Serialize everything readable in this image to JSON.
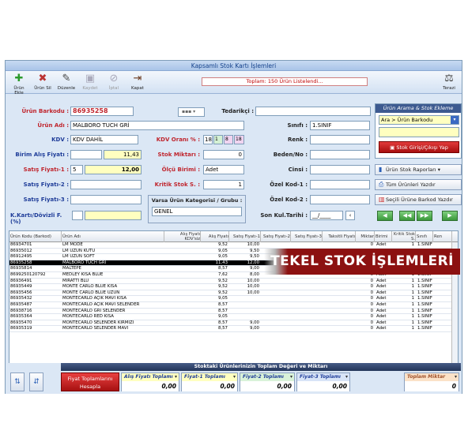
{
  "window": {
    "title": "Kapsamlı Stok Kartı İşlemleri"
  },
  "toolbar": {
    "buttons": [
      {
        "label": "Ürün Ekle",
        "icon": "plus-icon"
      },
      {
        "label": "Ürün Sil",
        "icon": "delete-icon"
      },
      {
        "label": "Düzenle",
        "icon": "edit-icon"
      },
      {
        "label": "Kaydet",
        "icon": "save-icon"
      },
      {
        "label": "İptal",
        "icon": "cancel-icon"
      },
      {
        "label": "Kapat",
        "icon": "exit-icon"
      }
    ],
    "banner": "Toplam: 150 Ürün Listelendi...",
    "terazi": "Terazi"
  },
  "form": {
    "barcode_label": "Ürün Barkodu :",
    "barcode": "86935258",
    "tedarikci_label": "Tedarikçi :",
    "tedarikci": "",
    "urun_adi_label": "Ürün Adı :",
    "urun_adi": "MALBORO TUCH GRİ",
    "sinifi_label": "Sınıfı :",
    "sinifi": "1.SINIF",
    "kdv_label": "KDV :",
    "kdv": "KDV DAHİL",
    "kdv_orani_label": "KDV Oranı % :",
    "kdv_rates": [
      "18",
      "1",
      "8",
      "18"
    ],
    "renk_label": "Renk :",
    "renk": "",
    "birim_alis_label": "Birim Alış Fiyatı :",
    "birim_alis": "11,43",
    "stok_miktari_label": "Stok Miktarı :",
    "stok_miktari": "0",
    "beden_label": "Beden/No :",
    "beden": "",
    "satis1_label": "Satış Fiyatı-1 :",
    "satis1_pct": "5",
    "satis1": "12,00",
    "olcu_label": "Ölçü Birimi :",
    "olcu": "Adet",
    "cinsi_label": "Cinsi :",
    "cinsi": "",
    "satis2_label": "Satış Fiyatı-2 :",
    "kritik_label": "Kritik Stok S. :",
    "kritik": "1",
    "ozel1_label": "Özel Kod-1 :",
    "satis3_label": "Satış Fiyatı-3 :",
    "grup_label": "Varsa Ürün Kategorisi / Grubu :",
    "grup": "GENEL",
    "ozel2_label": "Özel Kod-2 :",
    "kkarti_label": "K.Kartı/Dövizli F.(%)",
    "son_kul_label": "Son Kul.Tarihi :",
    "son_kul": "__/____"
  },
  "search": {
    "title": "Ürün Arama & Stok Ekleme",
    "selected": "Ara > Ürün Barkodu",
    "stok_button": "Stok Girişi/Çıkışı Yap"
  },
  "side_buttons": {
    "rapor": "Ürün Stok Raporları",
    "yazdir": "Tüm Ürünleri Yazdır",
    "barkod": "Seçili Ürüne Barkod Yazdır"
  },
  "grid": {
    "headers": [
      "Ürün Kodu (Barkod)",
      "Ürün Adı",
      "Alış Fiyatı KDV'siz",
      "Alış Fiyatı",
      "Satış Fiyatı-1",
      "Satış Fiyatı-2",
      "Satış Fiyatı-3",
      "Taksitli Fiyatı",
      "Miktar",
      "Birimi",
      "Kritik Stok S.",
      "Sınıfı",
      "Ren"
    ],
    "rows": [
      [
        "86934701",
        "LM MODE",
        "",
        "9,52",
        "10,00",
        "",
        "",
        "",
        "0",
        "Adet",
        "1",
        "1.SINIF"
      ],
      [
        "86935012",
        "LM UZUN KUTU",
        "",
        "9,05",
        "9,50",
        "",
        "",
        "",
        "0",
        "Adet",
        "1",
        "1.SINIF"
      ],
      [
        "86912495",
        "LM UZUN SOFT",
        "",
        "9,05",
        "9,50",
        "",
        "",
        "",
        "0",
        "Adet",
        "1",
        "1.SINIF"
      ],
      [
        "86935258",
        "MALBORO TUCH GRİ",
        "",
        "11,43",
        "12,00",
        "",
        "",
        "",
        "0",
        "Adet",
        "1",
        "1.SINIF"
      ],
      [
        "86935814",
        "MALTEPE",
        "",
        "8,57",
        "9,00",
        "",
        "",
        "",
        "0",
        "Adet",
        "1",
        "1.SINIF"
      ],
      [
        "8699250120792",
        "MEDLEY KISA BLUE",
        "",
        "7,62",
        "8,00",
        "",
        "",
        "",
        "0",
        "Adet",
        "1",
        "1.SINIF"
      ],
      [
        "86936491",
        "MİRATTİ BLU",
        "",
        "9,52",
        "10,00",
        "",
        "",
        "",
        "0",
        "Adet",
        "1",
        "1.SINIF"
      ],
      [
        "86935449",
        "MONTE CARLO BLUE KISA",
        "",
        "9,52",
        "10,00",
        "",
        "",
        "",
        "0",
        "Adet",
        "1",
        "1.SINIF"
      ],
      [
        "86935456",
        "MONTE CARLO BLUE UZUN",
        "",
        "9,52",
        "10,00",
        "",
        "",
        "",
        "0",
        "Adet",
        "1",
        "1.SINIF"
      ],
      [
        "86935432",
        "MONTECARLO AÇIK MAVİ KISA",
        "",
        "9,05",
        "",
        "",
        "",
        "",
        "0",
        "Adet",
        "1",
        "1.SINIF"
      ],
      [
        "86935487",
        "MONTECARLO AÇIK MAVİ SELENDER",
        "",
        "8,57",
        "",
        "",
        "",
        "",
        "0",
        "Adet",
        "1",
        "1.SINIF"
      ],
      [
        "86938716",
        "MONTECARLO GRİ SELENDER",
        "",
        "8,57",
        "",
        "",
        "",
        "",
        "0",
        "Adet",
        "1",
        "1.SINIF"
      ],
      [
        "86935364",
        "MONTECARLO RED KISA",
        "",
        "9,05",
        "",
        "",
        "",
        "",
        "0",
        "Adet",
        "1",
        "1.SINIF"
      ],
      [
        "86935470",
        "MONTECARLO SELENDER KIRMIZI",
        "",
        "8,57",
        "9,00",
        "",
        "",
        "",
        "0",
        "Adet",
        "1",
        "1.SINIF"
      ],
      [
        "86935319",
        "MONTECARLO SELENDER MAVİ",
        "",
        "8,57",
        "9,00",
        "",
        "",
        "",
        "0",
        "Adet",
        "1",
        "1.SINIF"
      ]
    ],
    "selected_index": 3
  },
  "overlay": "TEKEL STOK İŞLEMLERİ",
  "bottom": {
    "title": "Stoktaki Ürünlerinizin Toplam Değeri ve Miktarı",
    "fiyat_button": "Fiyat Toplamlarını Hesapla",
    "totals": [
      {
        "label": "Alış Fiyatı Toplamı",
        "value": "0,00"
      },
      {
        "label": "Fiyat-1 Toplamı",
        "value": "0,00"
      },
      {
        "label": "Fiyat-2 Toplamı",
        "value": "0,00"
      },
      {
        "label": "Fiyat-3 Toplamı",
        "value": "0,00"
      },
      {
        "label": "Toplam Miktar",
        "value": "0"
      }
    ]
  }
}
